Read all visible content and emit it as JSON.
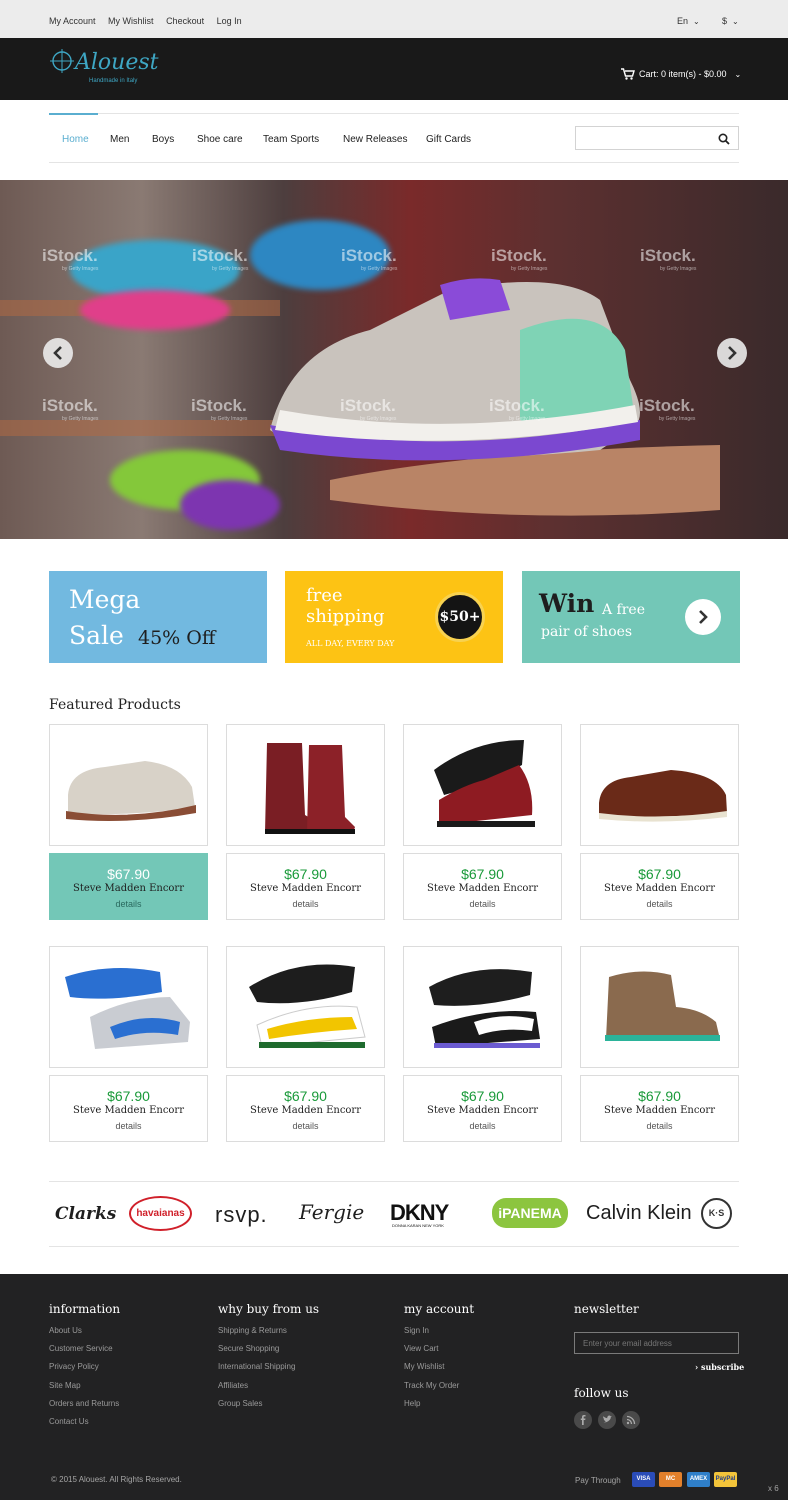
{
  "topbar": {
    "links": [
      "My Account",
      "My Wishlist",
      "Checkout",
      "Log In"
    ],
    "language": "En",
    "currency": "$"
  },
  "header": {
    "logo_name": "Alouest",
    "logo_tagline": "Handmade in Italy",
    "cart_label": "Cart: 0 item(s) - $0.00"
  },
  "nav": {
    "items": [
      "Home",
      "Men",
      "Boys",
      "Shoe care",
      "Team Sports",
      "New Releases",
      "Gift Cards"
    ],
    "active": "Home",
    "search_value": ""
  },
  "hero": {
    "watermark": "iStock.",
    "watermark_sub": "by Getty Images"
  },
  "promos": {
    "mega": {
      "line1": "Mega",
      "line2": "Sale",
      "off": "45% Off"
    },
    "shipping": {
      "title": "free shipping",
      "sub": "ALL DAY, EVERY DAY",
      "badge": "$50+"
    },
    "win": {
      "big": "Win",
      "line1": "A free",
      "line2": "pair of shoes"
    }
  },
  "featured": {
    "title": "Featured Products",
    "products": [
      {
        "price": "$67.90",
        "name": "Steve Madden Encorr",
        "details": "details"
      },
      {
        "price": "$67.90",
        "name": "Steve Madden Encorr",
        "details": "details"
      },
      {
        "price": "$67.90",
        "name": "Steve Madden Encorr",
        "details": "details"
      },
      {
        "price": "$67.90",
        "name": "Steve Madden Encorr",
        "details": "details"
      },
      {
        "price": "$67.90",
        "name": "Steve Madden Encorr",
        "details": "details"
      },
      {
        "price": "$67.90",
        "name": "Steve Madden Encorr",
        "details": "details"
      },
      {
        "price": "$67.90",
        "name": "Steve Madden Encorr",
        "details": "details"
      },
      {
        "price": "$67.90",
        "name": "Steve Madden Encorr",
        "details": "details"
      }
    ]
  },
  "brands": [
    "Clarks",
    "havaianas",
    "rsvp.",
    "Fergie",
    "DKNY",
    "DONNA KARAN NEW YORK",
    "iPANEMA",
    "Calvin Klein",
    "K·S"
  ],
  "footer": {
    "information": {
      "title": "information",
      "links": [
        "About Us",
        "Customer Service",
        "Privacy Policy",
        "Site Map",
        "Orders and Returns",
        "Contact Us"
      ]
    },
    "why": {
      "title": "why buy from us",
      "links": [
        "Shipping & Returns",
        "Secure Shopping",
        "International Shipping",
        "Affiliates",
        "Group Sales"
      ]
    },
    "account": {
      "title": "my account",
      "links": [
        "Sign In",
        "View Cart",
        "My Wishlist",
        "Track My Order",
        "Help"
      ]
    },
    "newsletter": {
      "title": "newsletter",
      "placeholder": "Enter your email address",
      "subscribe": "› subscribe"
    },
    "follow": "follow us",
    "copyright": "© 2015 Alouest. All Rights Reserved.",
    "pay_through": "Pay Through",
    "cards": [
      "VISA",
      "MC",
      "AMEX",
      "PayPal"
    ],
    "zoom": "x 6"
  },
  "colors": {
    "accent": "#5aaed0",
    "price": "#1a9a3a",
    "mega": "#72b9e0",
    "shipping": "#fdc314",
    "win": "#73c7b7"
  }
}
